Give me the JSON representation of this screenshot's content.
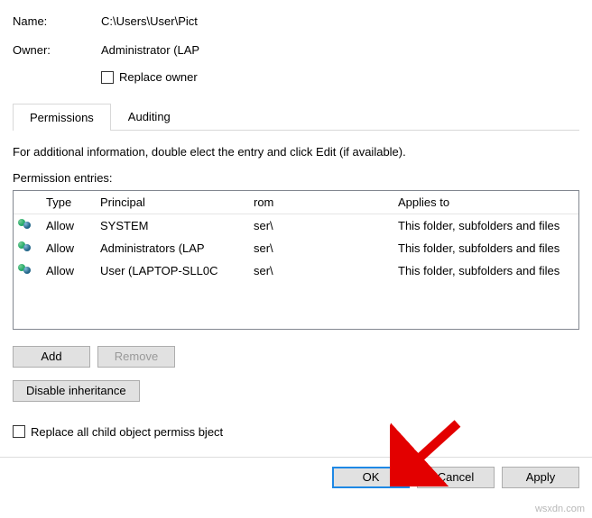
{
  "fields": {
    "name_label": "Name:",
    "name_value": "C:\\Users\\User\\Pict",
    "owner_label": "Owner:",
    "owner_value": "Administrator (LAP",
    "replace_owner_label": "Replace owner"
  },
  "tabs": {
    "permissions": "Permissions",
    "auditing": "Auditing"
  },
  "info_text": "For additional information, double        elect the entry and click Edit (if available).",
  "entries_label": "Permission entries:",
  "table": {
    "headers": {
      "type": "Type",
      "principal": "Principal",
      "from": "rom",
      "applies": "Applies to"
    },
    "rows": [
      {
        "type": "Allow",
        "principal": "SYSTEM",
        "from": "ser\\",
        "applies": "This folder, subfolders and files"
      },
      {
        "type": "Allow",
        "principal": "Administrators (LAP",
        "from": "ser\\",
        "applies": "This folder, subfolders and files"
      },
      {
        "type": "Allow",
        "principal": "User (LAPTOP-SLL0C",
        "from": "ser\\",
        "applies": "This folder, subfolders and files"
      }
    ]
  },
  "buttons": {
    "add": "Add",
    "remove": "Remove",
    "disable_inheritance": "Disable inheritance",
    "ok": "OK",
    "cancel": "Cancel",
    "apply": "Apply"
  },
  "replace_child_label": "Replace all child object permiss        bject",
  "watermark": "wsxdn.com"
}
